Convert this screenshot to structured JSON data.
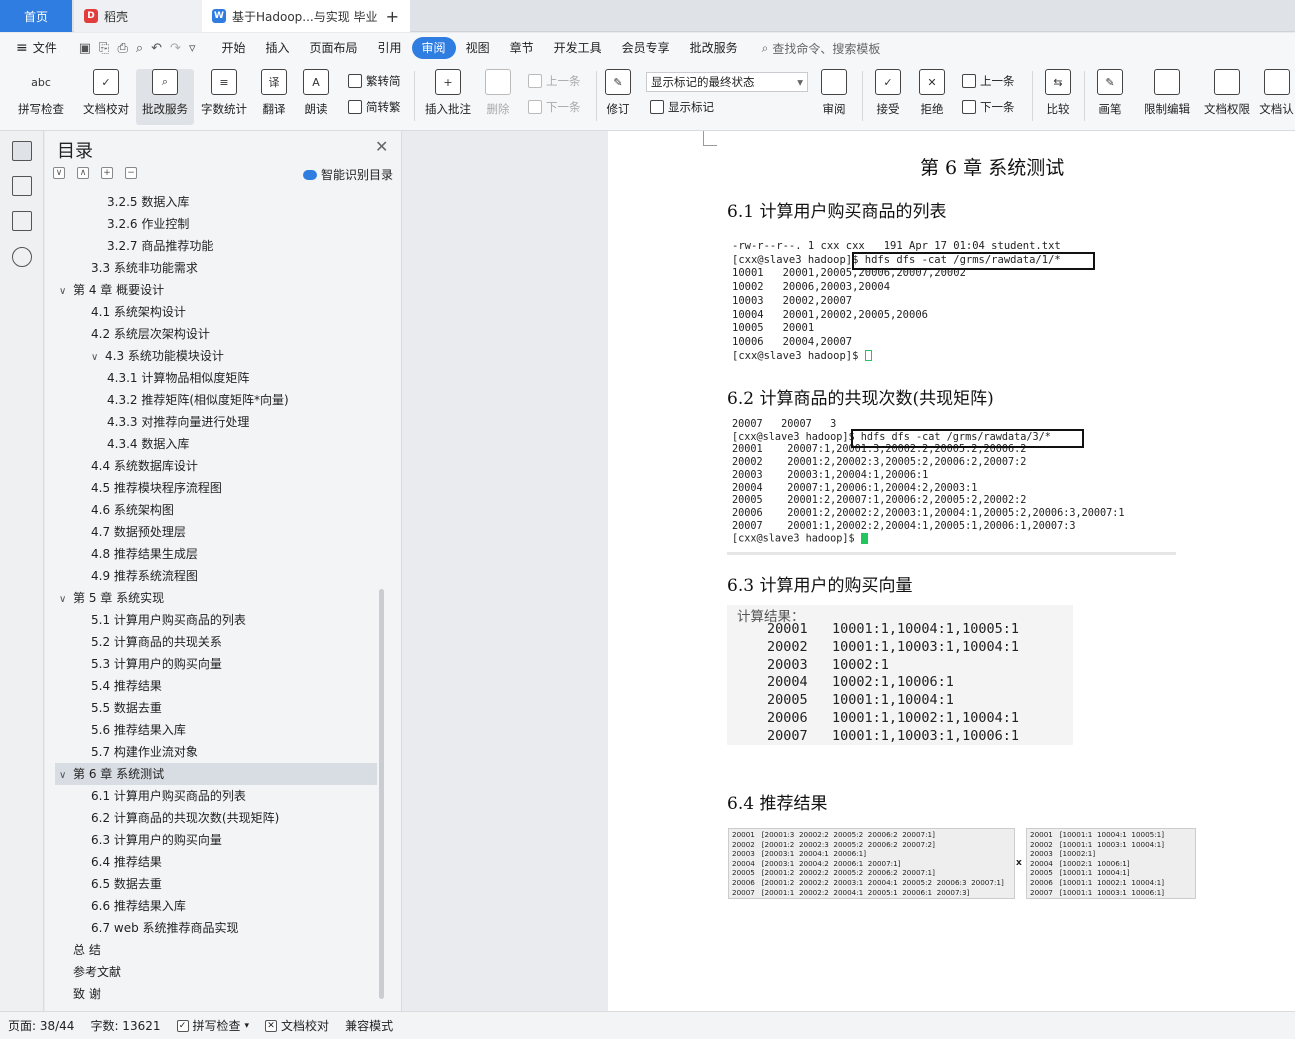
{
  "tabs": {
    "home": "首页",
    "shell": "稻壳",
    "doc": "基于Hadoop...与实现 毕业",
    "add": "+"
  },
  "menu": {
    "file": "文件",
    "items": [
      "开始",
      "插入",
      "页面布局",
      "引用",
      "审阅",
      "视图",
      "章节",
      "开发工具",
      "会员专享",
      "批改服务"
    ],
    "active": "审阅",
    "search": "查找命令、搜索模板"
  },
  "ribbon": {
    "spell": "拼写检查",
    "proof": "文档校对",
    "review_service": "批改服务",
    "word_count": "字数统计",
    "translate": "翻译",
    "read": "朗读",
    "trad": "繁转简",
    "simp": "简转繁",
    "insert_comment": "插入批注",
    "delete": "删除",
    "prev_comment": "上一条",
    "next_comment": "下一条",
    "track": "修订",
    "markup_state": "显示标记的最终状态",
    "show_markup": "显示标记",
    "review": "审阅",
    "accept": "接受",
    "reject": "拒绝",
    "prev_change": "上一条",
    "next_change": "下一条",
    "compare": "比较",
    "pen": "画笔",
    "restrict": "限制编辑",
    "permission": "文档权限",
    "cert": "文档认"
  },
  "toc": {
    "title": "目录",
    "smart": "智能识别目录",
    "items": [
      {
        "text": "3.2.5  数据入库",
        "level": 3
      },
      {
        "text": "3.2.6  作业控制",
        "level": 3
      },
      {
        "text": "3.2.7 商品推荐功能",
        "level": 3
      },
      {
        "text": "3.3  系统非功能需求",
        "level": 2
      },
      {
        "text": "第 4 章  概要设计",
        "level": 1,
        "caret": "∨"
      },
      {
        "text": "4.1 系统架构设计",
        "level": 2
      },
      {
        "text": "4.2 系统层次架构设计",
        "level": 2
      },
      {
        "text": "4.3 系统功能模块设计",
        "level": 2,
        "caret": "∨"
      },
      {
        "text": "4.3.1  计算物品相似度矩阵",
        "level": 3
      },
      {
        "text": "4.3.2 推荐矩阵(相似度矩阵*向量)",
        "level": 3
      },
      {
        "text": "4.3.3 对推荐向量进行处理",
        "level": 3
      },
      {
        "text": "4.3.4 数据入库",
        "level": 3
      },
      {
        "text": "4.4 系统数据库设计",
        "level": 2
      },
      {
        "text": "4.5 推荐模块程序流程图",
        "level": 2
      },
      {
        "text": "4.6 系统架构图",
        "level": 2
      },
      {
        "text": "4.7 数据预处理层",
        "level": 2
      },
      {
        "text": "4.8 推荐结果生成层",
        "level": 2
      },
      {
        "text": "4.9 推荐系统流程图",
        "level": 2
      },
      {
        "text": "第 5 章  系统实现",
        "level": 1,
        "caret": "∨"
      },
      {
        "text": "5.1 计算用户购买商品的列表",
        "level": 2
      },
      {
        "text": "5.2 计算商品的共现关系",
        "level": 2
      },
      {
        "text": "5.3 计算用户的购买向量",
        "level": 2
      },
      {
        "text": "5.4 推荐结果",
        "level": 2
      },
      {
        "text": "5.5 数据去重",
        "level": 2
      },
      {
        "text": "5.6 推荐结果入库",
        "level": 2
      },
      {
        "text": "5.7 构建作业流对象",
        "level": 2
      },
      {
        "text": "第 6 章  系统测试",
        "level": 1,
        "caret": "∨",
        "selected": true
      },
      {
        "text": "6.1 计算用户购买商品的列表",
        "level": 2
      },
      {
        "text": "6.2 计算商品的共现次数(共现矩阵)",
        "level": 2
      },
      {
        "text": "6.3 计算用户的购买向量",
        "level": 2
      },
      {
        "text": "6.4 推荐结果",
        "level": 2
      },
      {
        "text": "6.5 数据去重",
        "level": 2
      },
      {
        "text": "6.6 推荐结果入库",
        "level": 2
      },
      {
        "text": "6.7 web 系统推荐商品实现",
        "level": 2
      },
      {
        "text": "总    结",
        "level": 1
      },
      {
        "text": "参考文献",
        "level": 1
      },
      {
        "text": "致    谢",
        "level": 1
      }
    ]
  },
  "doc": {
    "chapter": "第 6 章  系统测试",
    "s61": "6.1 计算用户购买商品的列表",
    "term1": [
      "-rw-r--r--. 1 cxx cxx   191 Apr 17 01:04 student.txt",
      "[cxx@slave3 hadoop]$ hdfs dfs -cat /grms/rawdata/1/*",
      "10001   20001,20005,20006,20007,20002",
      "10002   20006,20003,20004",
      "10003   20002,20007",
      "10004   20001,20002,20005,20006",
      "10005   20001",
      "10006   20004,20007",
      "[cxx@slave3 hadoop]$ "
    ],
    "s62": "6.2 计算商品的共现次数(共现矩阵)",
    "term2": [
      "20007   20007   3",
      "[cxx@slave3 hadoop]$ hdfs dfs -cat /grms/rawdata/3/*",
      "20001    20007:1,20001:3,20002:2,20005:2,20006:2",
      "20002    20001:2,20002:3,20005:2,20006:2,20007:2",
      "20003    20003:1,20004:1,20006:1",
      "20004    20007:1,20006:1,20004:2,20003:1",
      "20005    20001:2,20007:1,20006:2,20005:2,20002:2",
      "20006    20001:2,20002:2,20003:1,20004:1,20005:2,20006:3,20007:1",
      "20007    20001:1,20002:2,20004:1,20005:1,20006:1,20007:3",
      "[cxx@slave3 hadoop]$ "
    ],
    "s63": "6.3 计算用户的购买向量",
    "calc_label": "计算结果：",
    "calc_rows": [
      "20001   10001:1,10004:1,10005:1",
      "20002   10001:1,10003:1,10004:1",
      "20003   10002:1",
      "20004   10002:1,10006:1",
      "20005   10001:1,10004:1",
      "20006   10001:1,10002:1,10004:1",
      "20007   10001:1,10003:1,10006:1"
    ],
    "s64": "6.4 推荐结果",
    "matrix_left": [
      "20001   [20001:3  20002:2  20005:2  20006:2  20007:1]",
      "20002   [20001:2  20002:3  20005:2  20006:2  20007:2]",
      "20003   [20003:1  20004:1  20006:1]",
      "20004   [20003:1  20004:2  20006:1  20007:1]",
      "20005   [20001:2  20002:2  20005:2  20006:2  20007:1]",
      "20006   [20001:2  20002:2  20003:1  20004:1  20005:2  20006:3  20007:1]",
      "20007   [20001:1  20002:2  20004:1  20005:1  20006:1  20007:3]"
    ],
    "times": "x",
    "matrix_right": [
      "20001   [10001:1  10004:1  10005:1]",
      "20002   [10001:1  10003:1  10004:1]",
      "20003   [10002:1]",
      "20004   [10002:1  10006:1]",
      "20005   [10001:1  10004:1]",
      "20006   [10001:1  10002:1  10004:1]",
      "20007   [10001:1  10003:1  10006:1]"
    ]
  },
  "status": {
    "page": "页面: 38/44",
    "words": "字数: 13621",
    "spell": "拼写检查",
    "proof": "文档校对",
    "compat": "兼容模式"
  },
  "colors": {
    "accent": "#2f7de1",
    "cursor": "#22c55e"
  }
}
